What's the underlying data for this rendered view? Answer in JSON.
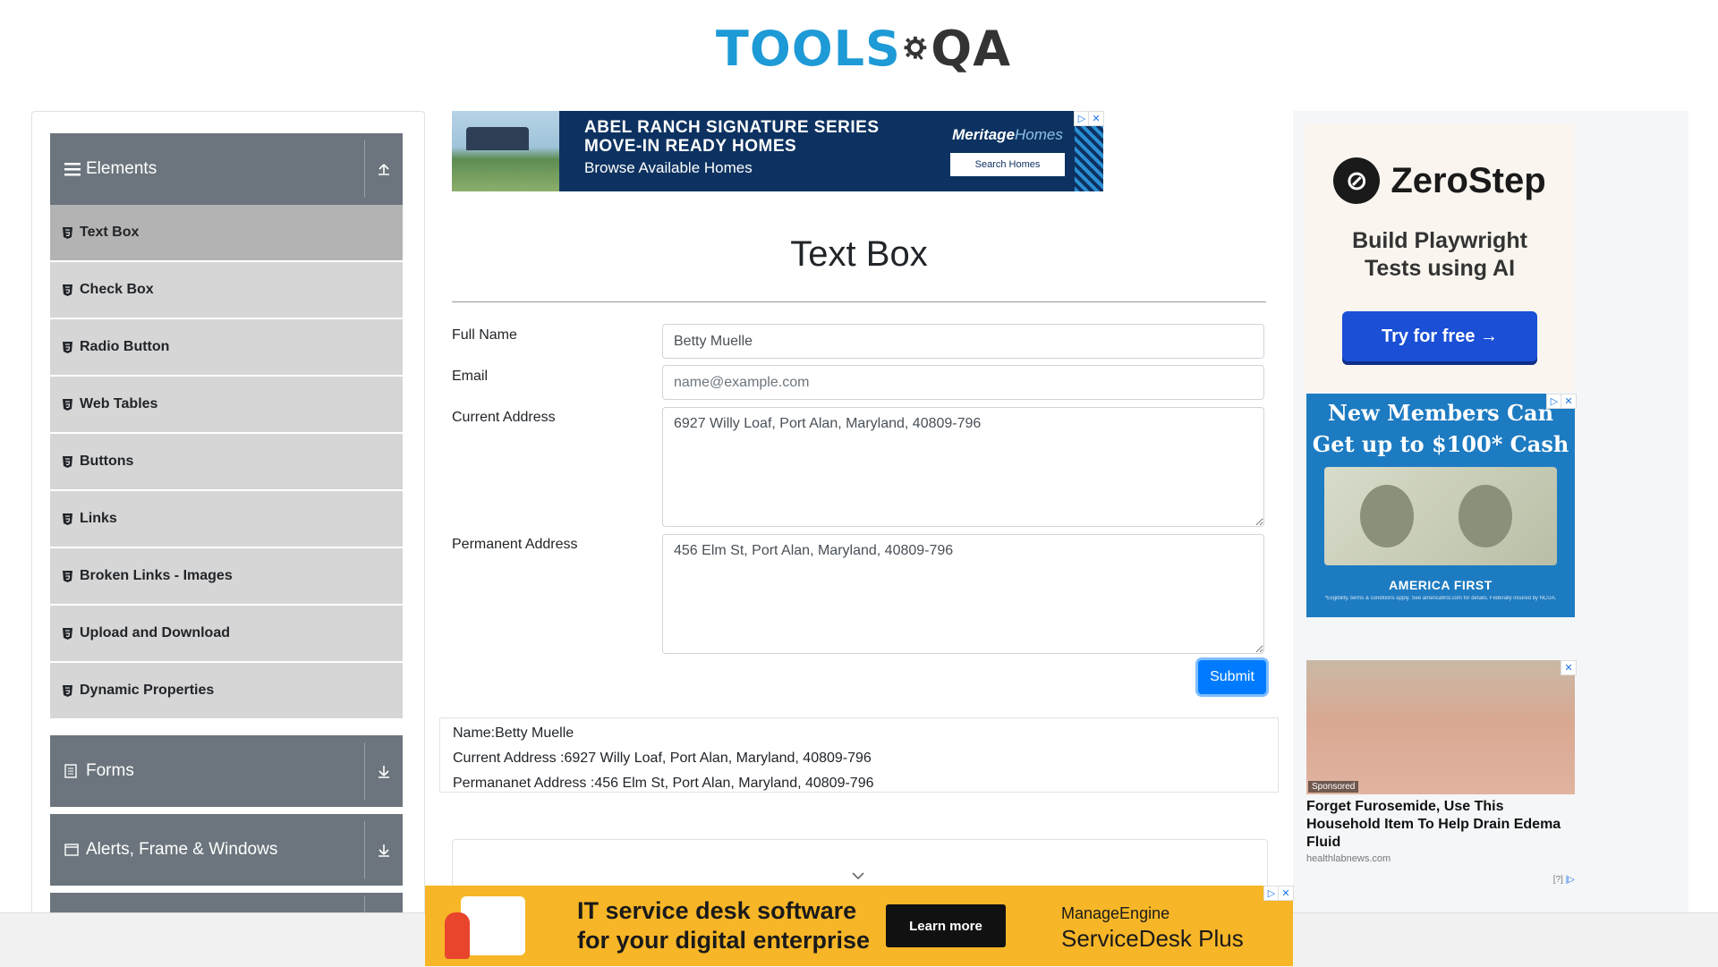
{
  "logo": {
    "tools": "TOOLS",
    "qa": "QA"
  },
  "sidebar": {
    "elements_header": "Elements",
    "items": [
      {
        "label": "Text Box",
        "active": true
      },
      {
        "label": "Check Box"
      },
      {
        "label": "Radio Button"
      },
      {
        "label": "Web Tables"
      },
      {
        "label": "Buttons"
      },
      {
        "label": "Links"
      },
      {
        "label": "Broken Links - Images"
      },
      {
        "label": "Upload and Download"
      },
      {
        "label": "Dynamic Properties"
      }
    ],
    "forms_header": "Forms",
    "alerts_header": "Alerts, Frame & Windows"
  },
  "top_ad": {
    "line1": "ABEL RANCH SIGNATURE SERIES",
    "line2": "MOVE-IN READY HOMES",
    "line3": "Browse Available Homes",
    "brand_a": "Meritage",
    "brand_b": "Homes",
    "button": "Search Homes"
  },
  "page": {
    "title": "Text Box"
  },
  "form": {
    "full_name_label": "Full Name",
    "full_name_value": "Betty Muelle",
    "email_label": "Email",
    "email_placeholder": "name@example.com",
    "current_address_label": "Current Address",
    "current_address_value": "6927 Willy Loaf, Port Alan, Maryland, 40809-796",
    "permanent_address_label": "Permanent Address",
    "permanent_address_value": "456 Elm St, Port Alan, Maryland, 40809-796",
    "submit_label": "Submit"
  },
  "output": {
    "name": "Name:Betty Muelle",
    "current_address": "Current Address :6927 Willy Loaf, Port Alan, Maryland, 40809-796",
    "permanent_address": "Permananet Address :456 Elm St, Port Alan, Maryland, 40809-796"
  },
  "right_ads": {
    "zerostep": {
      "brand": "ZeroStep",
      "tagline_1": "Build Playwright",
      "tagline_2": "Tests using AI",
      "cta": "Try for free →"
    },
    "credit_union": {
      "line1": "New Members Can",
      "line2": "Get up to $100* Cash",
      "brand": "AMERICA FIRST",
      "fine": "*Eligibility, terms & conditions apply. See americafirst.com for details. Federally insured by NCUA."
    },
    "native": {
      "sponsored": "Sponsored",
      "headline": "Forget Furosemide, Use This Household Item To Help Drain Edema Fluid",
      "source": "healthlabnews.com",
      "adchoices": "[?]"
    }
  },
  "bottom_ad": {
    "headline_1": "IT service desk software",
    "headline_2": "for your digital enterprise",
    "button": "Learn more",
    "brand_1": "ManageEngine",
    "brand_2": "ServiceDesk Plus"
  },
  "colors": {
    "sidebar_header": "#6c757d",
    "sidebar_item": "#d6d6d6",
    "sidebar_active": "#b3b3b3",
    "submit": "#007bff",
    "logo_blue": "#1e9ad6"
  }
}
